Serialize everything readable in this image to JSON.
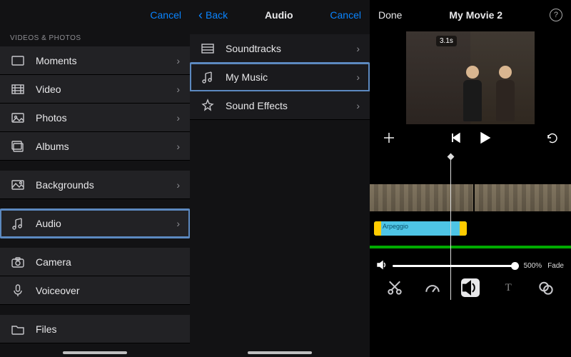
{
  "panel1": {
    "cancel": "Cancel",
    "section_header": "VIDEOS & PHOTOS",
    "rows_media": [
      {
        "icon": "moments",
        "label": "Moments"
      },
      {
        "icon": "video",
        "label": "Video"
      },
      {
        "icon": "photos",
        "label": "Photos"
      },
      {
        "icon": "albums",
        "label": "Albums"
      }
    ],
    "rows_bg": {
      "icon": "backgrounds",
      "label": "Backgrounds"
    },
    "rows_audio": {
      "icon": "audio",
      "label": "Audio"
    },
    "rows_cam": [
      {
        "icon": "camera",
        "label": "Camera"
      },
      {
        "icon": "voiceover",
        "label": "Voiceover"
      }
    ],
    "rows_files": {
      "icon": "files",
      "label": "Files"
    }
  },
  "panel2": {
    "back": "Back",
    "title": "Audio",
    "cancel": "Cancel",
    "rows": [
      {
        "icon": "soundtracks",
        "label": "Soundtracks"
      },
      {
        "icon": "mymusic",
        "label": "My Music"
      },
      {
        "icon": "soundfx",
        "label": "Sound Effects"
      }
    ]
  },
  "panel3": {
    "done": "Done",
    "title": "My Movie 2",
    "timestamp_badge": "3.1s",
    "audio_clip_label": "Arpeggio",
    "volume_pct": "500%",
    "fade_label": "Fade"
  }
}
